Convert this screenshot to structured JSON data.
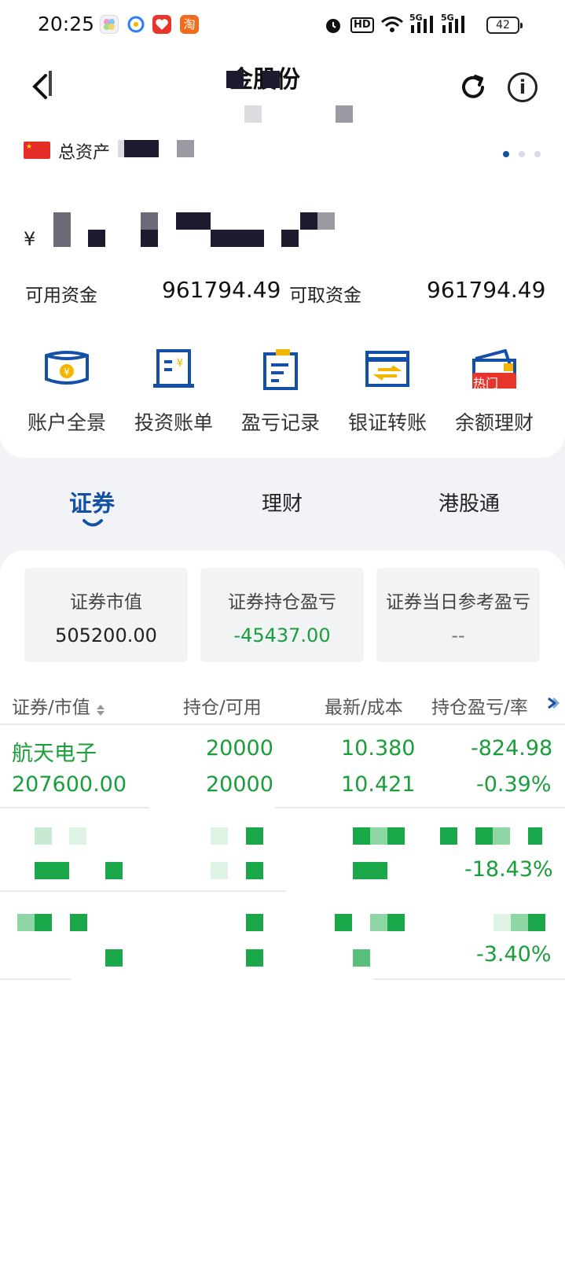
{
  "status_bar": {
    "time": "20:25",
    "battery": "42",
    "network_labels": [
      "HD",
      "5G",
      "5G"
    ],
    "icons": [
      "alarm-icon",
      "wifi-icon",
      "signal-icon",
      "battery-icon"
    ]
  },
  "apps": {
    "icons": [
      "photos-app-icon",
      "browser-app-icon",
      "red-app-icon",
      "taobao-app-icon"
    ],
    "taobao_glyph": "淘"
  },
  "header": {
    "title_visible": "金股份",
    "icons": [
      "back-icon",
      "refresh-icon",
      "info-icon"
    ]
  },
  "account": {
    "total_assets_label": "总资产",
    "currency_symbol": "¥",
    "available_funds_label": "可用资金",
    "available_funds_value": "961794.49",
    "withdrawable_funds_label": "可取资金",
    "withdrawable_funds_value": "961794.49",
    "page_indicator_count": 3,
    "page_indicator_active": 0
  },
  "actions": [
    {
      "label": "账户全景",
      "icon": "account-overview-icon"
    },
    {
      "label": "投资账单",
      "icon": "investment-bill-icon"
    },
    {
      "label": "盈亏记录",
      "icon": "profit-loss-record-icon"
    },
    {
      "label": "银证转账",
      "icon": "bank-transfer-icon"
    },
    {
      "label": "余额理财",
      "icon": "balance-wealth-icon",
      "badge": "热门"
    }
  ],
  "tabs": [
    {
      "label": "证券",
      "active": true
    },
    {
      "label": "理财",
      "active": false
    },
    {
      "label": "港股通",
      "active": false
    }
  ],
  "summary": [
    {
      "label": "证券市值",
      "value": "505200.00"
    },
    {
      "label": "证券持仓盈亏",
      "value": "-45437.00"
    },
    {
      "label": "证券当日参考盈亏",
      "value": "--"
    }
  ],
  "table": {
    "headers": [
      "证券/市值",
      "持仓/可用",
      "最新/成本",
      "持仓盈亏/率"
    ],
    "rows": [
      {
        "name": "航天电子",
        "market_value": "207600.00",
        "position": "20000",
        "available": "20000",
        "latest": "10.380",
        "cost": "10.421",
        "pnl": "-824.98",
        "pnl_rate": "-0.39%"
      },
      {
        "pnl_rate": "-18.43%"
      },
      {
        "pnl_rate": "-3.40%"
      }
    ]
  },
  "colors": {
    "accent": "#1550a8",
    "gain_loss_green": "#18a03c",
    "badge_red": "#e8352b",
    "page_bg": "#f2f3f7"
  }
}
